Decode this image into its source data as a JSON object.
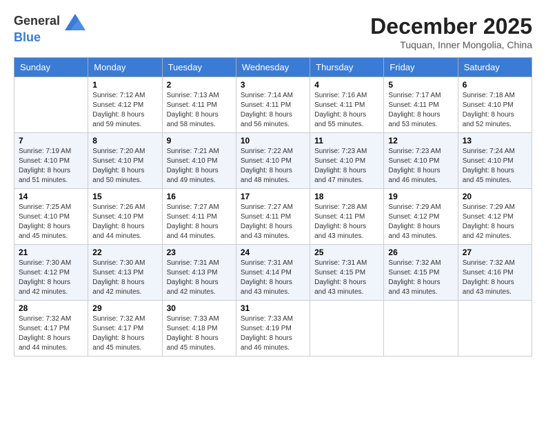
{
  "logo": {
    "text_general": "General",
    "text_blue": "Blue"
  },
  "header": {
    "month": "December 2025",
    "location": "Tuquan, Inner Mongolia, China"
  },
  "days_of_week": [
    "Sunday",
    "Monday",
    "Tuesday",
    "Wednesday",
    "Thursday",
    "Friday",
    "Saturday"
  ],
  "weeks": [
    [
      {
        "day": "",
        "sunrise": "",
        "sunset": "",
        "daylight": ""
      },
      {
        "day": "1",
        "sunrise": "Sunrise: 7:12 AM",
        "sunset": "Sunset: 4:12 PM",
        "daylight": "Daylight: 8 hours and 59 minutes."
      },
      {
        "day": "2",
        "sunrise": "Sunrise: 7:13 AM",
        "sunset": "Sunset: 4:11 PM",
        "daylight": "Daylight: 8 hours and 58 minutes."
      },
      {
        "day": "3",
        "sunrise": "Sunrise: 7:14 AM",
        "sunset": "Sunset: 4:11 PM",
        "daylight": "Daylight: 8 hours and 56 minutes."
      },
      {
        "day": "4",
        "sunrise": "Sunrise: 7:16 AM",
        "sunset": "Sunset: 4:11 PM",
        "daylight": "Daylight: 8 hours and 55 minutes."
      },
      {
        "day": "5",
        "sunrise": "Sunrise: 7:17 AM",
        "sunset": "Sunset: 4:11 PM",
        "daylight": "Daylight: 8 hours and 53 minutes."
      },
      {
        "day": "6",
        "sunrise": "Sunrise: 7:18 AM",
        "sunset": "Sunset: 4:10 PM",
        "daylight": "Daylight: 8 hours and 52 minutes."
      }
    ],
    [
      {
        "day": "7",
        "sunrise": "Sunrise: 7:19 AM",
        "sunset": "Sunset: 4:10 PM",
        "daylight": "Daylight: 8 hours and 51 minutes."
      },
      {
        "day": "8",
        "sunrise": "Sunrise: 7:20 AM",
        "sunset": "Sunset: 4:10 PM",
        "daylight": "Daylight: 8 hours and 50 minutes."
      },
      {
        "day": "9",
        "sunrise": "Sunrise: 7:21 AM",
        "sunset": "Sunset: 4:10 PM",
        "daylight": "Daylight: 8 hours and 49 minutes."
      },
      {
        "day": "10",
        "sunrise": "Sunrise: 7:22 AM",
        "sunset": "Sunset: 4:10 PM",
        "daylight": "Daylight: 8 hours and 48 minutes."
      },
      {
        "day": "11",
        "sunrise": "Sunrise: 7:23 AM",
        "sunset": "Sunset: 4:10 PM",
        "daylight": "Daylight: 8 hours and 47 minutes."
      },
      {
        "day": "12",
        "sunrise": "Sunrise: 7:23 AM",
        "sunset": "Sunset: 4:10 PM",
        "daylight": "Daylight: 8 hours and 46 minutes."
      },
      {
        "day": "13",
        "sunrise": "Sunrise: 7:24 AM",
        "sunset": "Sunset: 4:10 PM",
        "daylight": "Daylight: 8 hours and 45 minutes."
      }
    ],
    [
      {
        "day": "14",
        "sunrise": "Sunrise: 7:25 AM",
        "sunset": "Sunset: 4:10 PM",
        "daylight": "Daylight: 8 hours and 45 minutes."
      },
      {
        "day": "15",
        "sunrise": "Sunrise: 7:26 AM",
        "sunset": "Sunset: 4:10 PM",
        "daylight": "Daylight: 8 hours and 44 minutes."
      },
      {
        "day": "16",
        "sunrise": "Sunrise: 7:27 AM",
        "sunset": "Sunset: 4:11 PM",
        "daylight": "Daylight: 8 hours and 44 minutes."
      },
      {
        "day": "17",
        "sunrise": "Sunrise: 7:27 AM",
        "sunset": "Sunset: 4:11 PM",
        "daylight": "Daylight: 8 hours and 43 minutes."
      },
      {
        "day": "18",
        "sunrise": "Sunrise: 7:28 AM",
        "sunset": "Sunset: 4:11 PM",
        "daylight": "Daylight: 8 hours and 43 minutes."
      },
      {
        "day": "19",
        "sunrise": "Sunrise: 7:29 AM",
        "sunset": "Sunset: 4:12 PM",
        "daylight": "Daylight: 8 hours and 43 minutes."
      },
      {
        "day": "20",
        "sunrise": "Sunrise: 7:29 AM",
        "sunset": "Sunset: 4:12 PM",
        "daylight": "Daylight: 8 hours and 42 minutes."
      }
    ],
    [
      {
        "day": "21",
        "sunrise": "Sunrise: 7:30 AM",
        "sunset": "Sunset: 4:12 PM",
        "daylight": "Daylight: 8 hours and 42 minutes."
      },
      {
        "day": "22",
        "sunrise": "Sunrise: 7:30 AM",
        "sunset": "Sunset: 4:13 PM",
        "daylight": "Daylight: 8 hours and 42 minutes."
      },
      {
        "day": "23",
        "sunrise": "Sunrise: 7:31 AM",
        "sunset": "Sunset: 4:13 PM",
        "daylight": "Daylight: 8 hours and 42 minutes."
      },
      {
        "day": "24",
        "sunrise": "Sunrise: 7:31 AM",
        "sunset": "Sunset: 4:14 PM",
        "daylight": "Daylight: 8 hours and 43 minutes."
      },
      {
        "day": "25",
        "sunrise": "Sunrise: 7:31 AM",
        "sunset": "Sunset: 4:15 PM",
        "daylight": "Daylight: 8 hours and 43 minutes."
      },
      {
        "day": "26",
        "sunrise": "Sunrise: 7:32 AM",
        "sunset": "Sunset: 4:15 PM",
        "daylight": "Daylight: 8 hours and 43 minutes."
      },
      {
        "day": "27",
        "sunrise": "Sunrise: 7:32 AM",
        "sunset": "Sunset: 4:16 PM",
        "daylight": "Daylight: 8 hours and 43 minutes."
      }
    ],
    [
      {
        "day": "28",
        "sunrise": "Sunrise: 7:32 AM",
        "sunset": "Sunset: 4:17 PM",
        "daylight": "Daylight: 8 hours and 44 minutes."
      },
      {
        "day": "29",
        "sunrise": "Sunrise: 7:32 AM",
        "sunset": "Sunset: 4:17 PM",
        "daylight": "Daylight: 8 hours and 45 minutes."
      },
      {
        "day": "30",
        "sunrise": "Sunrise: 7:33 AM",
        "sunset": "Sunset: 4:18 PM",
        "daylight": "Daylight: 8 hours and 45 minutes."
      },
      {
        "day": "31",
        "sunrise": "Sunrise: 7:33 AM",
        "sunset": "Sunset: 4:19 PM",
        "daylight": "Daylight: 8 hours and 46 minutes."
      },
      {
        "day": "",
        "sunrise": "",
        "sunset": "",
        "daylight": ""
      },
      {
        "day": "",
        "sunrise": "",
        "sunset": "",
        "daylight": ""
      },
      {
        "day": "",
        "sunrise": "",
        "sunset": "",
        "daylight": ""
      }
    ]
  ]
}
